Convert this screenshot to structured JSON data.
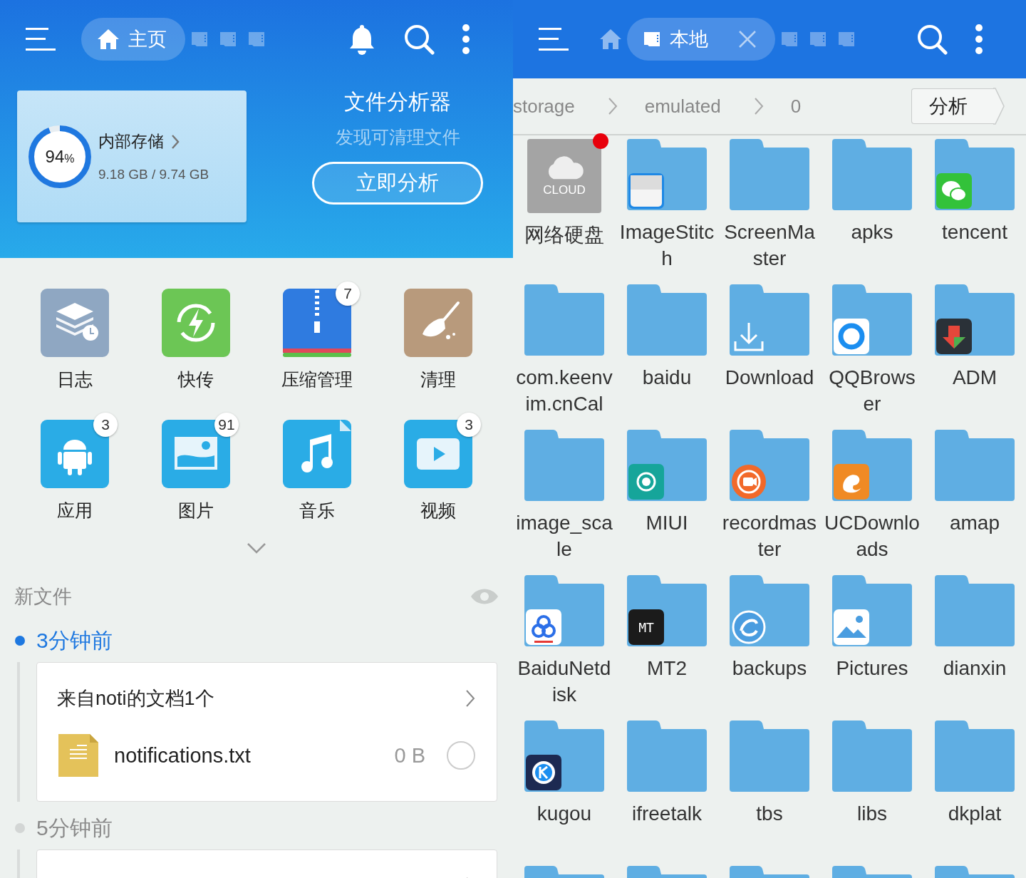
{
  "left": {
    "topbar": {
      "tabs": [
        {
          "kind": "home",
          "label": "主页",
          "selected": true
        },
        {
          "kind": "sd",
          "selected": false
        },
        {
          "kind": "sd",
          "selected": false
        },
        {
          "kind": "sd",
          "selected": false
        }
      ],
      "actions": [
        {
          "kind": "bell"
        },
        {
          "kind": "search"
        },
        {
          "kind": "more"
        }
      ]
    },
    "storage": {
      "title": "内部存储",
      "percent": "94",
      "unit": "%",
      "level": 0.94,
      "usage": "9.18 GB / 9.74 GB"
    },
    "analyzer": {
      "title": "文件分析器",
      "subtitle": "发现可清理文件",
      "button": "立即分析"
    },
    "tools": [
      {
        "kind": "log",
        "label": "日志"
      },
      {
        "kind": "transfer",
        "label": "快传"
      },
      {
        "kind": "zip",
        "label": "压缩管理",
        "badge": "7"
      },
      {
        "kind": "clean",
        "label": "清理"
      },
      {
        "kind": "apps",
        "label": "应用",
        "badge": "3"
      },
      {
        "kind": "images",
        "label": "图片",
        "badge": "91"
      },
      {
        "kind": "music",
        "label": "音乐"
      },
      {
        "kind": "video",
        "label": "视频",
        "badge": "3"
      }
    ],
    "new_files": {
      "title": "新文件",
      "groups": [
        {
          "time": "3分钟前",
          "current": true,
          "card_title": "来自noti的文档1个",
          "files": [
            {
              "name": "notifications.txt",
              "size": "0 B",
              "checked": false
            }
          ]
        },
        {
          "time": "5分钟前",
          "current": false
        }
      ]
    }
  },
  "right": {
    "topbar": {
      "tabs": [
        {
          "kind": "home",
          "selected": false
        },
        {
          "kind": "sd",
          "label": "本地",
          "selected": true,
          "closable": true
        },
        {
          "kind": "sd",
          "selected": false
        },
        {
          "kind": "sd",
          "selected": false
        },
        {
          "kind": "sd",
          "selected": false
        }
      ],
      "actions": [
        {
          "kind": "search"
        },
        {
          "kind": "more"
        }
      ]
    },
    "breadcrumb": [
      "storage",
      "emulated",
      "0"
    ],
    "analyze_button": "分析",
    "folders": [
      {
        "kind": "cloud",
        "name": "网络硬盘",
        "icon_label": "CLOUD",
        "notification": true
      },
      {
        "kind": "imagestitch",
        "name": "ImageStitch"
      },
      {
        "kind": "folder",
        "name": "ScreenMaster"
      },
      {
        "kind": "folder",
        "name": "apks"
      },
      {
        "kind": "wechat",
        "name": "tencent"
      },
      {
        "kind": "folder",
        "name": "com.keenvim.cnCal"
      },
      {
        "kind": "folder",
        "name": "baidu"
      },
      {
        "kind": "download",
        "name": "Download"
      },
      {
        "kind": "qqbrowser",
        "name": "QQBrowser"
      },
      {
        "kind": "adm",
        "name": "ADM"
      },
      {
        "kind": "folder",
        "name": "image_scale"
      },
      {
        "kind": "miui",
        "name": "MIUI"
      },
      {
        "kind": "recordmaster",
        "name": "recordmaster"
      },
      {
        "kind": "uc",
        "name": "UCDownloads"
      },
      {
        "kind": "folder",
        "name": "amap"
      },
      {
        "kind": "baidunetdisk",
        "name": "BaiduNetdisk"
      },
      {
        "kind": "mt2",
        "name": "MT2",
        "icon_label": "MT"
      },
      {
        "kind": "es",
        "name": "backups"
      },
      {
        "kind": "pictures",
        "name": "Pictures"
      },
      {
        "kind": "folder",
        "name": "dianxin"
      },
      {
        "kind": "kugou",
        "name": "kugou"
      },
      {
        "kind": "folder",
        "name": "ifreetalk"
      },
      {
        "kind": "folder",
        "name": "tbs"
      },
      {
        "kind": "folder",
        "name": "libs"
      },
      {
        "kind": "folder",
        "name": "dkplat"
      },
      {
        "kind": "folder"
      },
      {
        "kind": "folder"
      },
      {
        "kind": "folder"
      },
      {
        "kind": "folder"
      },
      {
        "kind": "folder"
      }
    ]
  }
}
